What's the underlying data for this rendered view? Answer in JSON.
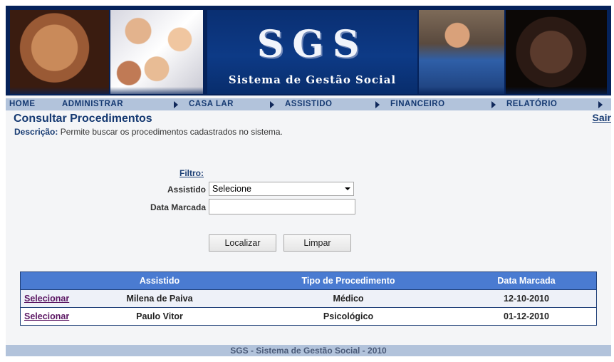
{
  "banner": {
    "title": "SGS",
    "subtitle": "Sistema de Gestão Social"
  },
  "menu": {
    "items": [
      {
        "label": "HOME"
      },
      {
        "label": "ADMINISTRAR"
      },
      {
        "label": "CASA LAR"
      },
      {
        "label": "ASSISTIDO"
      },
      {
        "label": "FINANCEIRO"
      },
      {
        "label": "RELATÓRIO"
      }
    ]
  },
  "page": {
    "title": "Consultar Procedimentos",
    "logout": "Sair",
    "description_label": "Descrição:",
    "description_text": "Permite buscar os procedimentos cadastrados no sistema."
  },
  "filter": {
    "heading": "Filtro:",
    "assistido_label": "Assistido",
    "assistido_value": "Selecione",
    "data_label": "Data Marcada",
    "data_value": "",
    "search_button": "Localizar",
    "clear_button": "Limpar"
  },
  "table": {
    "headers": [
      "",
      "Assistido",
      "Tipo de Procedimento",
      "Data Marcada"
    ],
    "rows": [
      {
        "action": "Selecionar",
        "assistido": "Milena de Paiva",
        "tipo": "Médico",
        "data": "12-10-2010"
      },
      {
        "action": "Selecionar",
        "assistido": "Paulo Vitor",
        "tipo": "Psicológico",
        "data": "01-12-2010"
      }
    ]
  },
  "footer": {
    "text": "SGS - Sistema de Gestão Social - 2010"
  },
  "colors": {
    "banner": "#05225a",
    "menu_bar": "#b2c3db",
    "table_header": "#4a7bd1",
    "title": "#163a72",
    "link": "#5b1663"
  }
}
